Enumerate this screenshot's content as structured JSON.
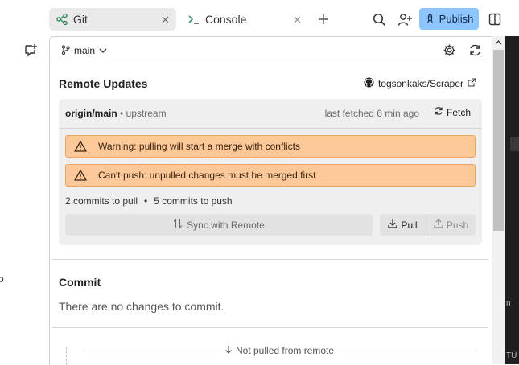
{
  "tabs": [
    {
      "label": "Git",
      "icon": "git-branch-icon",
      "active": true
    },
    {
      "label": "Console",
      "icon": "terminal-icon",
      "active": false
    }
  ],
  "toolbar": {
    "publish_label": "Publish"
  },
  "branch": {
    "name": "main"
  },
  "remote_updates": {
    "title": "Remote Updates",
    "repo": "togsonkaks/Scraper",
    "remote_name": "origin/main",
    "remote_tag": "upstream",
    "separator": "•",
    "last_fetched": "last fetched 6 min ago",
    "fetch_label": "Fetch",
    "warnings": [
      "Warning: pulling will start a merge with conflicts",
      "Can't push: unpulled changes must be merged first"
    ],
    "commits_to_pull": "2 commits to pull",
    "commits_to_push": "5 commits to push",
    "sync_label": "Sync with Remote",
    "pull_label": "Pull",
    "push_label": "Push"
  },
  "commit": {
    "title": "Commit",
    "empty_message": "There are no changes to commit."
  },
  "history": {
    "not_pulled_label": "Not pulled from remote"
  },
  "edge_text": {
    "left": "o",
    "right_1": "n",
    "right_2": "TU"
  },
  "colors": {
    "accent": "#8ec5fc",
    "warning_bg": "#fdc898",
    "warning_border": "#e9a764",
    "card_bg": "#efefef"
  }
}
